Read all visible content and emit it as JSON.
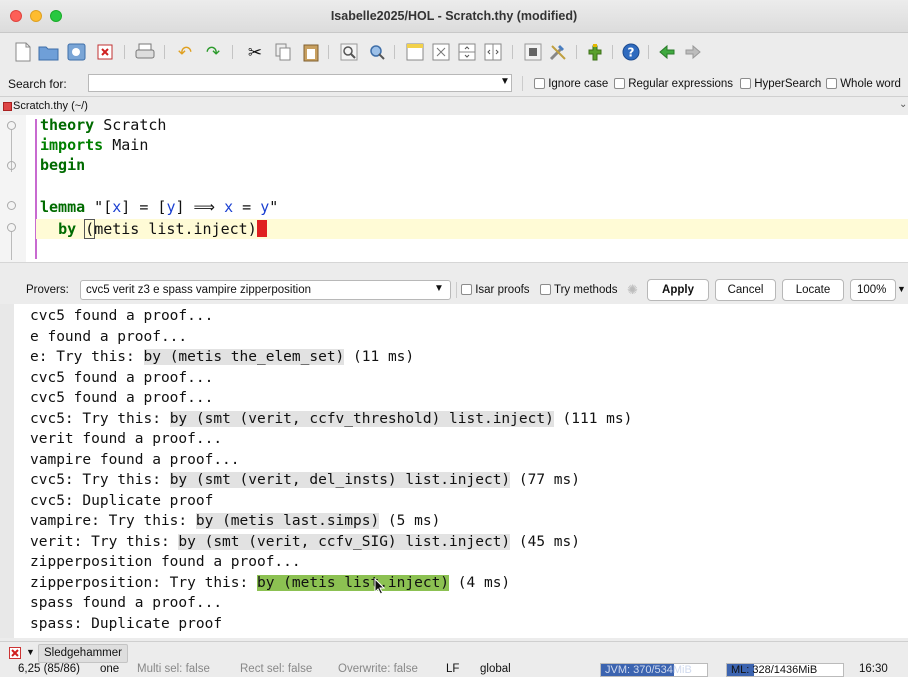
{
  "window": {
    "title": "Isabelle2025/HOL - Scratch.thy (modified)"
  },
  "search": {
    "label": "Search for:",
    "value": "",
    "options": [
      "Ignore case",
      "Regular expressions",
      "HyperSearch",
      "Whole word"
    ]
  },
  "file_tab": {
    "label": "Scratch.thy (~/)"
  },
  "editor": {
    "line1": {
      "kw": "theory",
      "rest": " Scratch"
    },
    "line2": {
      "kw": "imports",
      "rest": " Main"
    },
    "line3": {
      "kw": "begin"
    },
    "line5": {
      "kw": "lemma",
      "q1": " \"[",
      "x1": "x",
      "mid1": "] = [",
      "y1": "y",
      "mid2": "] ⟹ ",
      "x2": "x",
      "eq": " = ",
      "y2": "y",
      "q2": "\""
    },
    "line6": {
      "indent": "  ",
      "kw": "by",
      "sp": " ",
      "paren": "(",
      "rest": "metis list.inject)"
    }
  },
  "prover_bar": {
    "label": "Provers:",
    "provers": "cvc5 verit z3 e spass vampire zipperposition",
    "isar_label": "Isar proofs",
    "try_label": "Try methods",
    "apply": "Apply",
    "cancel": "Cancel",
    "locate": "Locate",
    "zoom": "100%"
  },
  "output": {
    "lines": [
      {
        "pre": "cvc5 found a proof..."
      },
      {
        "pre": "e found a proof..."
      },
      {
        "pre": "e: Try this: ",
        "cmd": "by (metis the_elem_set)",
        "post": " (11 ms)"
      },
      {
        "pre": "cvc5 found a proof..."
      },
      {
        "pre": "cvc5 found a proof..."
      },
      {
        "pre": "cvc5: Try this: ",
        "cmd": "by (smt (verit, ccfv_threshold) list.inject)",
        "post": " (111 ms)"
      },
      {
        "pre": "verit found a proof..."
      },
      {
        "pre": "vampire found a proof..."
      },
      {
        "pre": "cvc5: Try this: ",
        "cmd": "by (smt (verit, del_insts) list.inject)",
        "post": " (77 ms)"
      },
      {
        "pre": "cvc5: Duplicate proof"
      },
      {
        "pre": "vampire: Try this: ",
        "cmd": "by (metis last.simps)",
        "post": " (5 ms)"
      },
      {
        "pre": "verit: Try this: ",
        "cmd": "by (smt (verit, ccfv_SIG) list.inject)",
        "post": " (45 ms)"
      },
      {
        "pre": "zipperposition found a proof..."
      },
      {
        "pre": "zipperposition: Try this: ",
        "cmd": "by (metis list.inject)",
        "post": " (4 ms)",
        "active": true
      },
      {
        "pre": "spass found a proof..."
      },
      {
        "pre": "spass: Duplicate proof"
      }
    ]
  },
  "dock": {
    "label": "Sledgehammer"
  },
  "status": {
    "pos": "6,25 (85/86)",
    "mode": "one",
    "multi": "Multi sel: false",
    "rect": "Rect sel: false",
    "overwrite": "Overwrite: false",
    "lf": "LF",
    "global": "global",
    "jvm": "JVM: 370/534MiB",
    "ml": "ML: 328/1436MiB",
    "time": "16:30"
  },
  "colors": {
    "accent_green": "#8cc152",
    "keyword": "#008000",
    "variable": "#1a3fd1",
    "cursor": "#e02020",
    "highlight": "#fffbd6"
  }
}
